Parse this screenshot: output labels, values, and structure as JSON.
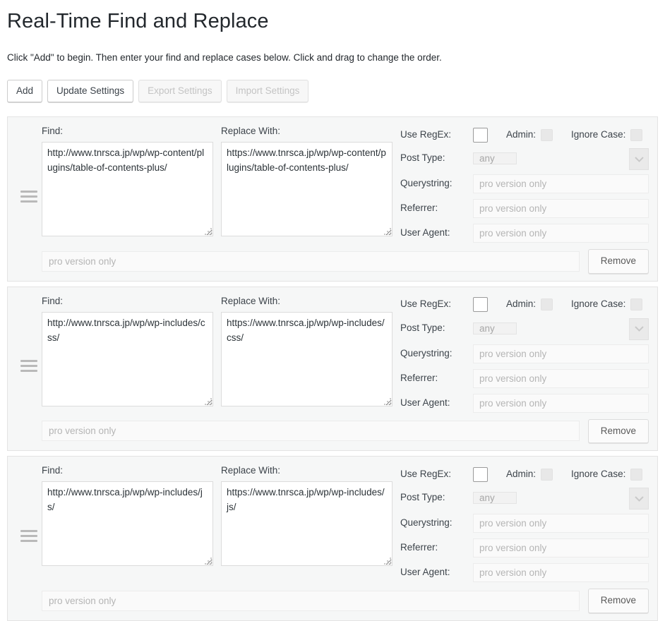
{
  "page": {
    "title": "Real-Time Find and Replace",
    "description": "Click \"Add\" to begin. Then enter your find and replace cases below. Click and drag to change the order."
  },
  "toolbar": {
    "buttons": [
      {
        "label": "Add",
        "name": "add-button",
        "disabled": false
      },
      {
        "label": "Update Settings",
        "name": "update-settings-button",
        "disabled": false
      },
      {
        "label": "Export Settings",
        "name": "export-settings-button",
        "disabled": true
      },
      {
        "label": "Import Settings",
        "name": "import-settings-button",
        "disabled": true
      }
    ]
  },
  "labels": {
    "find": "Find:",
    "replace_with": "Replace With:",
    "use_regex": "Use RegEx:",
    "admin": "Admin:",
    "ignore_case": "Ignore Case:",
    "post_type": "Post Type:",
    "querystring": "Querystring:",
    "referrer": "Referrer:",
    "user_agent": "User Agent:",
    "remove": "Remove"
  },
  "placeholders": {
    "pro_version_only": "pro version only"
  },
  "values": {
    "post_type_selected": "any"
  },
  "colors": {
    "page_background": "#ffffff",
    "row_background": "#f6f7f7",
    "row_border": "#e3e3e3",
    "text": "#32373c",
    "muted_text": "#b5b5b5",
    "disabled_button_text": "#c4c4c4",
    "input_border": "#dcdcdc",
    "drag_handle": "#b9b9b9"
  },
  "rows": [
    {
      "find": "http://www.tnrsca.jp/wp/wp-content/plugins/table-of-contents-plus/",
      "replace": "https://www.tnrsca.jp/wp/wp-content/plugins/table-of-contents-plus/",
      "use_regex_checked": false,
      "post_type": "any",
      "querystring": "pro version only",
      "referrer": "pro version only",
      "user_agent": "pro version only",
      "footer_field": "pro version only",
      "remove_label": "Remove"
    },
    {
      "find": "http://www.tnrsca.jp/wp/wp-includes/css/",
      "replace": "https://www.tnrsca.jp/wp/wp-includes/css/",
      "use_regex_checked": false,
      "post_type": "any",
      "querystring": "pro version only",
      "referrer": "pro version only",
      "user_agent": "pro version only",
      "footer_field": "pro version only",
      "remove_label": "Remove"
    },
    {
      "find": "http://www.tnrsca.jp/wp/wp-includes/js/",
      "replace": "https://www.tnrsca.jp/wp/wp-includes/js/",
      "use_regex_checked": false,
      "post_type": "any",
      "querystring": "pro version only",
      "referrer": "pro version only",
      "user_agent": "pro version only",
      "footer_field": "pro version only",
      "remove_label": "Remove"
    }
  ],
  "icons": {
    "drag_handle": "drag-handle-icon",
    "chevron_down": "chevron-down-icon",
    "resize_grip": "resize-grip-icon"
  }
}
